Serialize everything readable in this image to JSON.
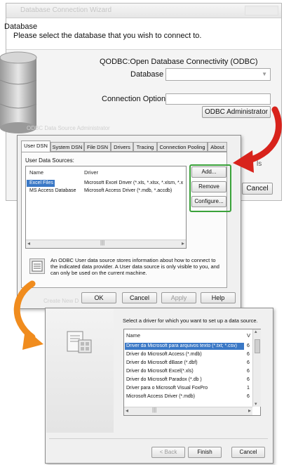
{
  "wizard": {
    "title": "Database Connection Wizard",
    "heading": "Database",
    "subheading": "Please select the database that you wish to connect to.",
    "odbc_title": "QODBC:Open Database Connectivity (ODBC)",
    "database_label": "Database",
    "database_value": "",
    "connection_options_label": "Connection Options",
    "connection_options_value": "",
    "odbc_admin_label": "ODBC Administrator",
    "cancel_label": "Cancel",
    "right_fragment": "ls"
  },
  "odbc_admin": {
    "ghost_title": "ODBC Data Source Administrator",
    "tabs": [
      "User DSN",
      "System DSN",
      "File DSN",
      "Drivers",
      "Tracing",
      "Connection Pooling",
      "About"
    ],
    "user_data_sources_label": "User Data Sources:",
    "columns": [
      "Name",
      "Driver"
    ],
    "rows": [
      {
        "name": "Excel Files",
        "driver": "Microsoft Excel Driver (*.xls, *.xlsx, *.xlsm, *.x"
      },
      {
        "name": "MS Access Database",
        "driver": "Microsoft Access Driver (*.mdb, *.accdb)"
      }
    ],
    "side_buttons": {
      "add": "Add...",
      "remove": "Remove",
      "configure": "Configure..."
    },
    "info_text": "An ODBC User data source stores information about how to connect to the indicated data provider.  A User data source is only visible to you, and can only be used on the current machine.",
    "bottom_buttons": {
      "ok": "OK",
      "cancel": "Cancel",
      "apply": "Apply",
      "help": "Help"
    },
    "ghost_bottom": "Create New D"
  },
  "create_new": {
    "prompt": "Select a driver for which you want to set up a data source.",
    "columns": [
      "Name",
      "V"
    ],
    "drivers": [
      {
        "name": "Driver da Microsoft para arquivos texto (*.txt; *.csv)",
        "v": "6"
      },
      {
        "name": "Driver do Microsoft Access (*.mdb)",
        "v": "6"
      },
      {
        "name": "Driver do Microsoft dBase (*.dbf)",
        "v": "6"
      },
      {
        "name": "Driver do Microsoft Excel(*.xls)",
        "v": "6"
      },
      {
        "name": "Driver do Microsoft Paradox (*.db )",
        "v": "6"
      },
      {
        "name": "Driver para o Microsoft Visual FoxPro",
        "v": "1"
      },
      {
        "name": "Microsoft Access Driver (*.mdb)",
        "v": "6"
      }
    ],
    "buttons": {
      "back": "< Back",
      "finish": "Finish",
      "cancel": "Cancel"
    }
  },
  "colors": {
    "highlight_green": "#3aa23a",
    "arrow_red": "#d8231c",
    "arrow_orange": "#f08c1e",
    "selection_blue": "#3a78c6"
  }
}
